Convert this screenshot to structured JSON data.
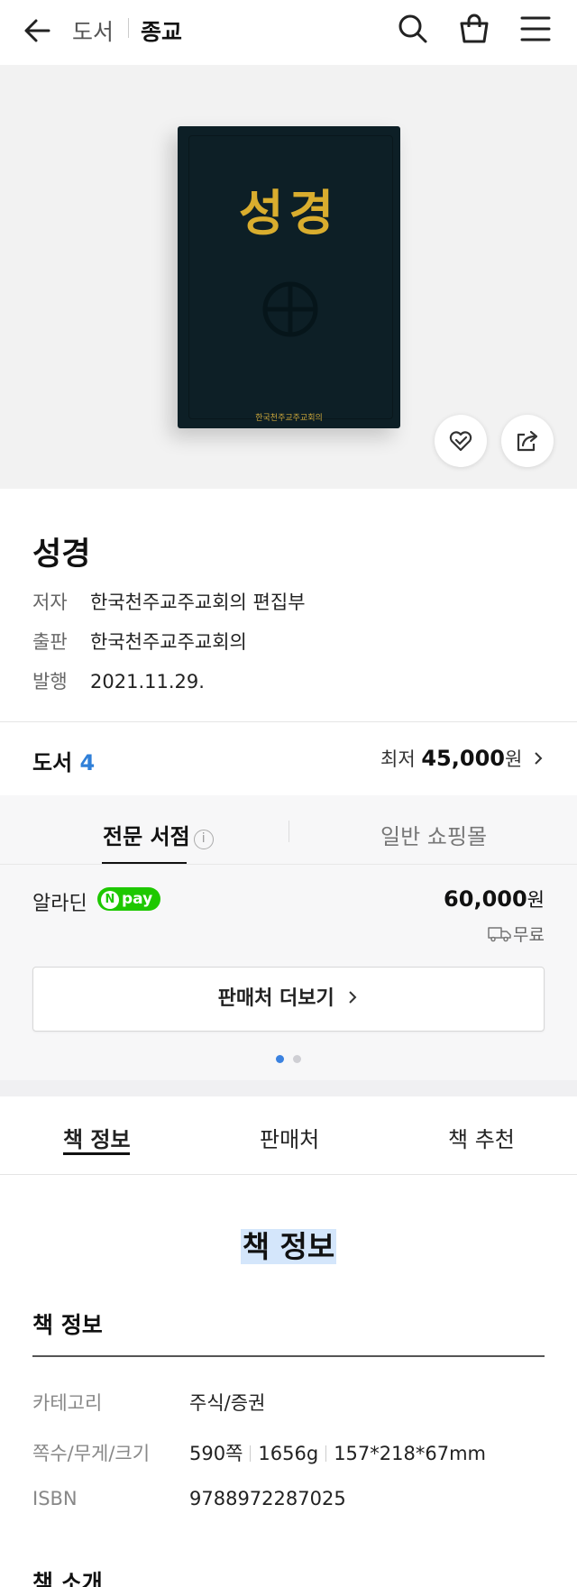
{
  "header": {
    "crumb_category": "도서",
    "crumb_subcategory": "종교"
  },
  "book_cover": {
    "title": "성경",
    "publisher": "한국천주교주교회의"
  },
  "book": {
    "title": "성경",
    "author_label": "저자",
    "author": "한국천주교주교회의 편집부",
    "publisher_label": "출판",
    "publisher": "한국천주교주교회의",
    "date_label": "발행",
    "date": "2021.11.29."
  },
  "summary": {
    "type_label": "도서",
    "count": "4",
    "lowest_label": "최저",
    "lowest_price": "45,000",
    "won": "원"
  },
  "seller_tabs": {
    "active": "전문 서점",
    "info_glyph": "i",
    "inactive": "일반 쇼핑몰"
  },
  "seller": {
    "name": "알라딘",
    "pay_n": "N",
    "pay_label": "pay",
    "price": "60,000",
    "won": "원",
    "shipping": "무료",
    "more_button": "판매처 더보기"
  },
  "pager": {
    "current": 1,
    "total": 2
  },
  "content_tabs": [
    "책 정보",
    "판매처",
    "책 추천"
  ],
  "book_info": {
    "section_title": "책 정보",
    "sub_title": "책 정보",
    "category_label": "카테고리",
    "category": "주식/증권",
    "specs_label": "쪽수/무게/크기",
    "pages": "590쪽",
    "weight": "1656g",
    "size": "157*218*67mm",
    "isbn_label": "ISBN",
    "isbn": "9788972287025",
    "next_section": "책 소개"
  },
  "colors": {
    "accent_blue": "#2f7fd8",
    "npay_green": "#1ec800",
    "cover_dark": "#0d1f26",
    "cover_gold": "#d9ad2e",
    "highlight": "#d4e6fb"
  }
}
